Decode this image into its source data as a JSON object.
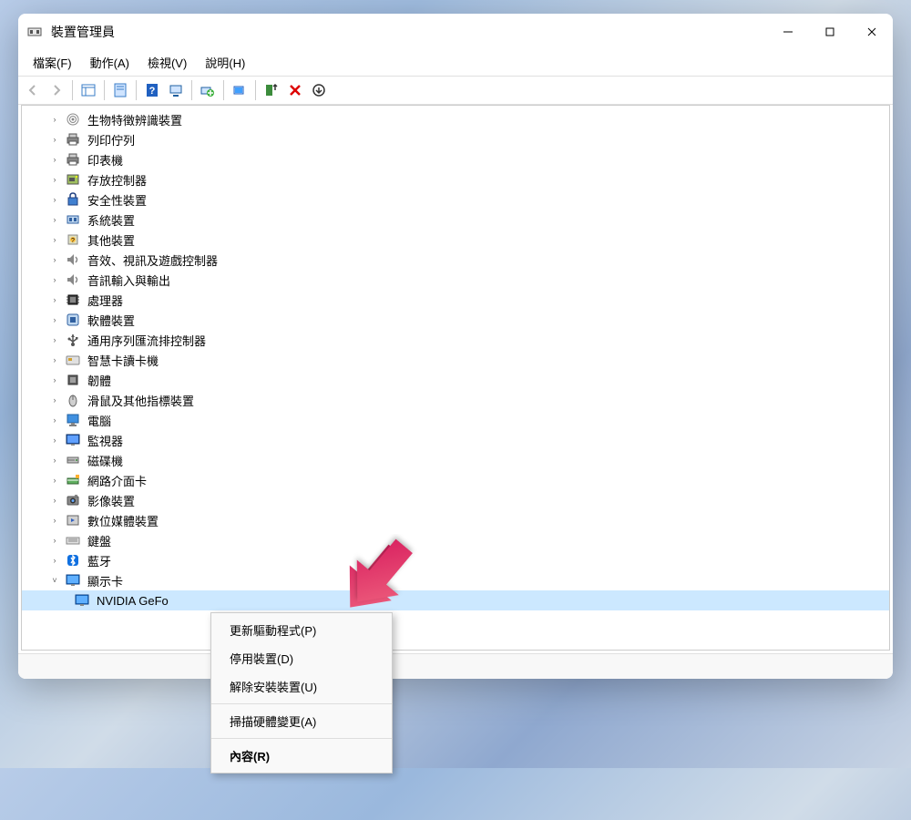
{
  "window": {
    "title": "裝置管理員"
  },
  "menu": {
    "file": "檔案(F)",
    "action": "動作(A)",
    "view": "檢視(V)",
    "help": "說明(H)"
  },
  "tree": {
    "items": [
      {
        "label": "生物特徵辨識裝置",
        "icon": "fingerprint",
        "expanded": false
      },
      {
        "label": "列印佇列",
        "icon": "printer",
        "expanded": false
      },
      {
        "label": "印表機",
        "icon": "printer",
        "expanded": false
      },
      {
        "label": "存放控制器",
        "icon": "storage",
        "expanded": false
      },
      {
        "label": "安全性裝置",
        "icon": "security",
        "expanded": false
      },
      {
        "label": "系統裝置",
        "icon": "system",
        "expanded": false
      },
      {
        "label": "其他裝置",
        "icon": "other",
        "expanded": false
      },
      {
        "label": "音效、視訊及遊戲控制器",
        "icon": "audio",
        "expanded": false
      },
      {
        "label": "音訊輸入與輸出",
        "icon": "audio",
        "expanded": false
      },
      {
        "label": "處理器",
        "icon": "cpu",
        "expanded": false
      },
      {
        "label": "軟體裝置",
        "icon": "software",
        "expanded": false
      },
      {
        "label": "通用序列匯流排控制器",
        "icon": "usb",
        "expanded": false
      },
      {
        "label": "智慧卡讀卡機",
        "icon": "smartcard",
        "expanded": false
      },
      {
        "label": "韌體",
        "icon": "firmware",
        "expanded": false
      },
      {
        "label": "滑鼠及其他指標裝置",
        "icon": "mouse",
        "expanded": false
      },
      {
        "label": "電腦",
        "icon": "computer",
        "expanded": false
      },
      {
        "label": "監視器",
        "icon": "monitor",
        "expanded": false
      },
      {
        "label": "磁碟機",
        "icon": "disk",
        "expanded": false
      },
      {
        "label": "網路介面卡",
        "icon": "network",
        "expanded": false
      },
      {
        "label": "影像裝置",
        "icon": "camera",
        "expanded": false
      },
      {
        "label": "數位媒體裝置",
        "icon": "media",
        "expanded": false
      },
      {
        "label": "鍵盤",
        "icon": "keyboard",
        "expanded": false
      },
      {
        "label": "藍牙",
        "icon": "bluetooth",
        "expanded": false
      },
      {
        "label": "顯示卡",
        "icon": "display",
        "expanded": true
      }
    ],
    "selected": {
      "label": "NVIDIA GeFo"
    }
  },
  "context": {
    "update": "更新驅動程式(P)",
    "disable": "停用裝置(D)",
    "uninstall": "解除安裝裝置(U)",
    "scan": "掃描硬體變更(A)",
    "properties": "內容(R)"
  }
}
